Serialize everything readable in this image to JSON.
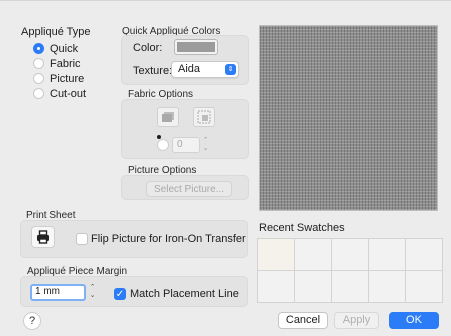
{
  "applique_type": {
    "title": "Appliqué Type",
    "options": [
      {
        "label": "Quick",
        "selected": true
      },
      {
        "label": "Fabric",
        "selected": false
      },
      {
        "label": "Picture",
        "selected": false
      },
      {
        "label": "Cut-out",
        "selected": false
      }
    ]
  },
  "quick_colors": {
    "title": "Quick Appliqué Colors",
    "color_label": "Color:",
    "color_value": "#9b9b9b",
    "texture_label": "Texture:",
    "texture_value": "Aida"
  },
  "fabric_options": {
    "title": "Fabric Options",
    "angle_value": "0"
  },
  "picture_options": {
    "title": "Picture Options",
    "select_label": "Select Picture..."
  },
  "print_sheet": {
    "title": "Print Sheet",
    "flip_label": "Flip Picture for Iron-On Transfer",
    "flip_checked": false
  },
  "recent_swatches": {
    "title": "Recent Swatches"
  },
  "margin": {
    "title": "Appliqué Piece Margin",
    "value": "1 mm",
    "match_label": "Match Placement Line",
    "match_checked": true
  },
  "footer": {
    "help": "?",
    "cancel": "Cancel",
    "apply": "Apply",
    "ok": "OK"
  },
  "colors": {
    "accent": "#2b7cf6",
    "preview": "#8e8e8e"
  }
}
